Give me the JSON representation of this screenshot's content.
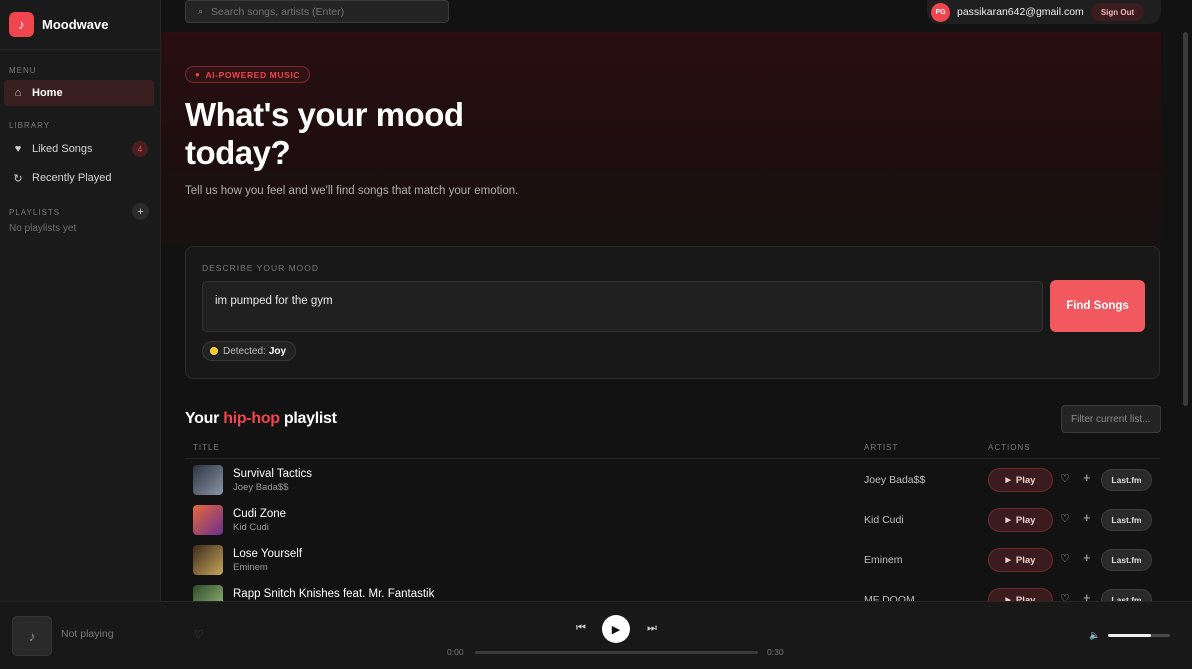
{
  "app": {
    "name": "Moodwave",
    "logo_glyph": "♪"
  },
  "sidebar": {
    "menu_label": "MENU",
    "home": {
      "label": "Home",
      "icon": "home-icon",
      "glyph": "⌂"
    },
    "library_label": "LIBRARY",
    "liked": {
      "label": "Liked Songs",
      "icon": "heart-icon",
      "glyph": "♥",
      "count": "4"
    },
    "recent": {
      "label": "Recently Played",
      "icon": "history-icon",
      "glyph": "↻"
    },
    "playlists_label": "PLAYLISTS",
    "add_glyph": "+",
    "no_playlists": "No playlists yet"
  },
  "topbar": {
    "search_placeholder": "Search songs, artists (Enter)",
    "search_glyph": "⌕",
    "avatar_initials": "PG",
    "user_email": "passikaran642@gmail.com",
    "signout_label": "Sign Out"
  },
  "hero": {
    "tag": "AI-POWERED MUSIC",
    "title": "What's your mood today?",
    "subtitle": "Tell us how you feel and we'll find songs that match your emotion."
  },
  "mood": {
    "label": "DESCRIBE YOUR MOOD",
    "input_value": "im pumped for the gym",
    "find_label": "Find Songs",
    "detected_prefix": "Detected:",
    "detected_emotion": "Joy"
  },
  "playlist": {
    "title_prefix": "Your",
    "genre": "hip-hop",
    "title_suffix": "playlist",
    "filter_placeholder": "Filter current list...",
    "columns": {
      "title": "TITLE",
      "artist": "ARTIST",
      "actions": "ACTIONS"
    },
    "play_label": "Play",
    "lastfm_label": "Last.fm",
    "tracks": [
      {
        "title": "Survival Tactics",
        "artist": "Joey Bada$$",
        "cover": [
          "#2c3440",
          "#8a95a8"
        ]
      },
      {
        "title": "Cudi Zone",
        "artist": "Kid Cudi",
        "cover": [
          "#e7683a",
          "#6a2f8f"
        ]
      },
      {
        "title": "Lose Yourself",
        "artist": "Eminem",
        "cover": [
          "#3a2b1c",
          "#c9a45a"
        ]
      },
      {
        "title": "Rapp Snitch Knishes feat. Mr. Fantastik",
        "artist": "MF DOOM",
        "cover": [
          "#2f4a2a",
          "#9cc07a"
        ]
      }
    ]
  },
  "player": {
    "now_playing": "Not playing",
    "time_current": "0:00",
    "time_total": "0:30",
    "progress": 0.0,
    "volume": 0.7
  },
  "colors": {
    "accent": "#f0444e",
    "background": "#121212",
    "sidebar": "#1a1a1a"
  }
}
